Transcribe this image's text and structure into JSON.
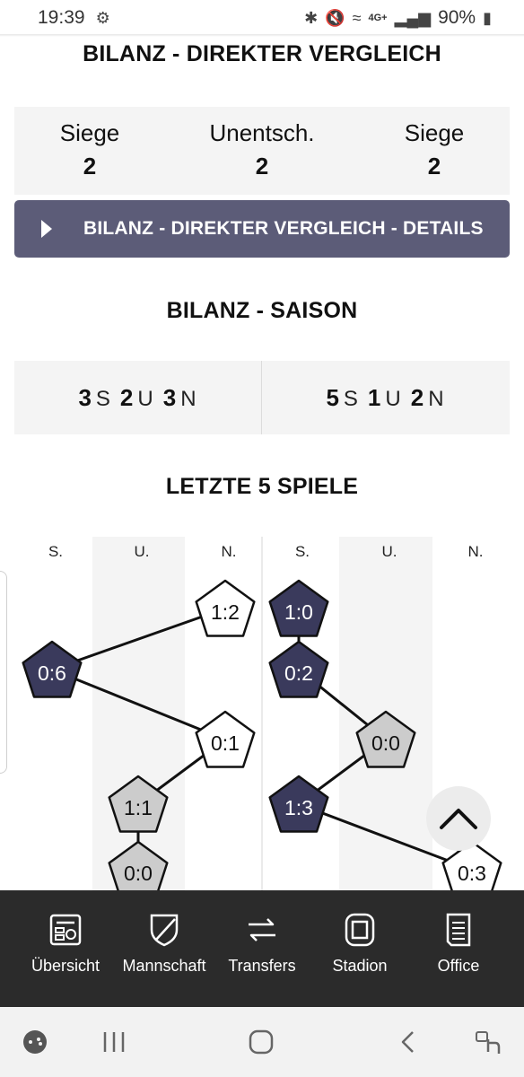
{
  "status_bar": {
    "time": "19:39",
    "network": "4G+",
    "battery": "90%"
  },
  "direct_comparison": {
    "title": "BILANZ - DIREKTER VERGLEICH",
    "columns": [
      {
        "label": "Siege",
        "value": "2"
      },
      {
        "label": "Unentsch.",
        "value": "2"
      },
      {
        "label": "Siege",
        "value": "2"
      }
    ],
    "details_button": "BILANZ - DIREKTER VERGLEICH - DETAILS"
  },
  "season": {
    "title": "BILANZ - SAISON",
    "left": {
      "s_count": "3",
      "s": "S",
      "u_count": "2",
      "u": "U",
      "n_count": "3",
      "n": "N"
    },
    "right": {
      "s_count": "5",
      "s": "S",
      "u_count": "1",
      "u": "U",
      "n_count": "2",
      "n": "N"
    }
  },
  "last5": {
    "title": "LETZTE 5 SPIELE",
    "column_headers": [
      "S.",
      "U.",
      "N.",
      "S.",
      "U.",
      "N."
    ],
    "left_team": [
      {
        "score": "1:2",
        "result": "N"
      },
      {
        "score": "0:6",
        "result": "S"
      },
      {
        "score": "0:1",
        "result": "N"
      },
      {
        "score": "1:1",
        "result": "U"
      },
      {
        "score": "0:0",
        "result": "U"
      }
    ],
    "right_team": [
      {
        "score": "1:0",
        "result": "S"
      },
      {
        "score": "0:2",
        "result": "S"
      },
      {
        "score": "0:0",
        "result": "U"
      },
      {
        "score": "1:3",
        "result": "S"
      },
      {
        "score": "0:3",
        "result": "N"
      }
    ],
    "colors": {
      "win": "#3a3a5c",
      "draw": "#cccccc",
      "loss": "#ffffff"
    }
  },
  "bottom_nav": {
    "items": [
      {
        "label": "Übersicht",
        "icon": "overview-icon"
      },
      {
        "label": "Mannschaft",
        "icon": "shield-icon"
      },
      {
        "label": "Transfers",
        "icon": "transfer-arrows-icon"
      },
      {
        "label": "Stadion",
        "icon": "stadium-icon"
      },
      {
        "label": "Office",
        "icon": "document-icon"
      }
    ]
  }
}
